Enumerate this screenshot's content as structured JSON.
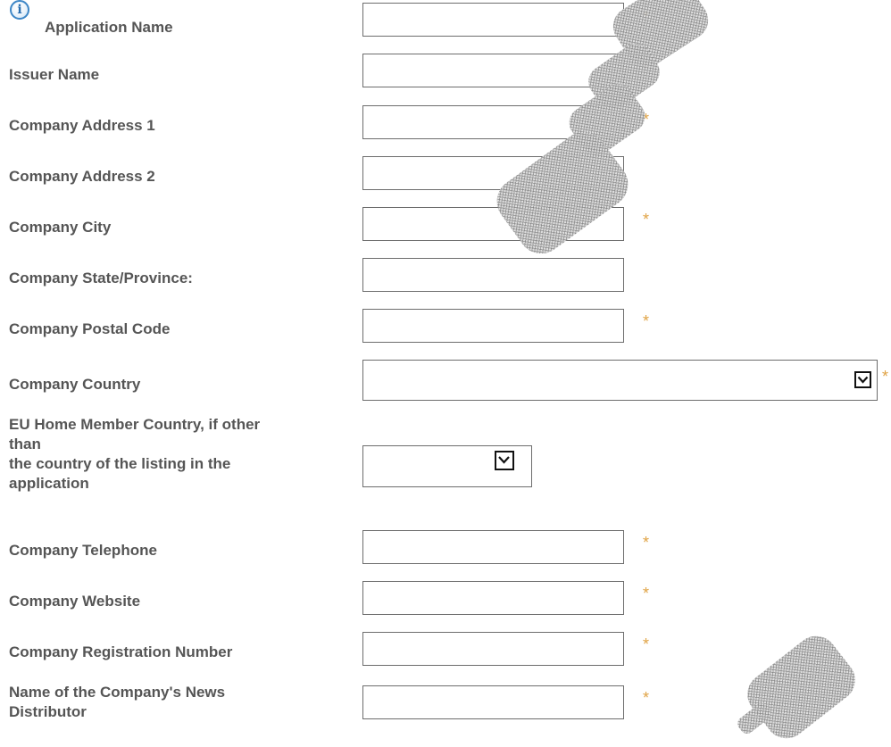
{
  "required_marker": "*",
  "accent_color": "#e0a345",
  "fields": {
    "application_name": {
      "label": "Application Name",
      "value": "",
      "required": true
    },
    "issuer_name": {
      "label": "Issuer Name",
      "value": "",
      "required": true
    },
    "company_address_1": {
      "label": "Company Address 1",
      "value": "",
      "required": true
    },
    "company_address_2": {
      "label": "Company Address 2",
      "value": "",
      "required": false
    },
    "company_city": {
      "label": "Company City",
      "value": "",
      "required": true
    },
    "company_state": {
      "label": "Company State/Province:",
      "value": "",
      "required": false
    },
    "company_postal_code": {
      "label": "Company Postal Code",
      "value": "",
      "required": true
    },
    "company_country": {
      "label": "Company Country",
      "selected": "",
      "required": true
    },
    "eu_home_member_country": {
      "label_lines": [
        "EU Home Member Country, if other",
        "than",
        "the country of the listing in the",
        "application"
      ],
      "selected": "",
      "required": false
    },
    "company_telephone": {
      "label": "Company Telephone",
      "value": "",
      "required": true
    },
    "company_website": {
      "label": "Company Website",
      "value": "",
      "required": true
    },
    "company_registration_number": {
      "label": "Company Registration Number",
      "value": "",
      "required": true
    },
    "news_distributor": {
      "label_lines": [
        "Name of the Company's News",
        "Distributor"
      ],
      "value": "",
      "required": true
    }
  },
  "icons": {
    "info": "info-icon",
    "dropdown": "chevron-down-icon"
  }
}
